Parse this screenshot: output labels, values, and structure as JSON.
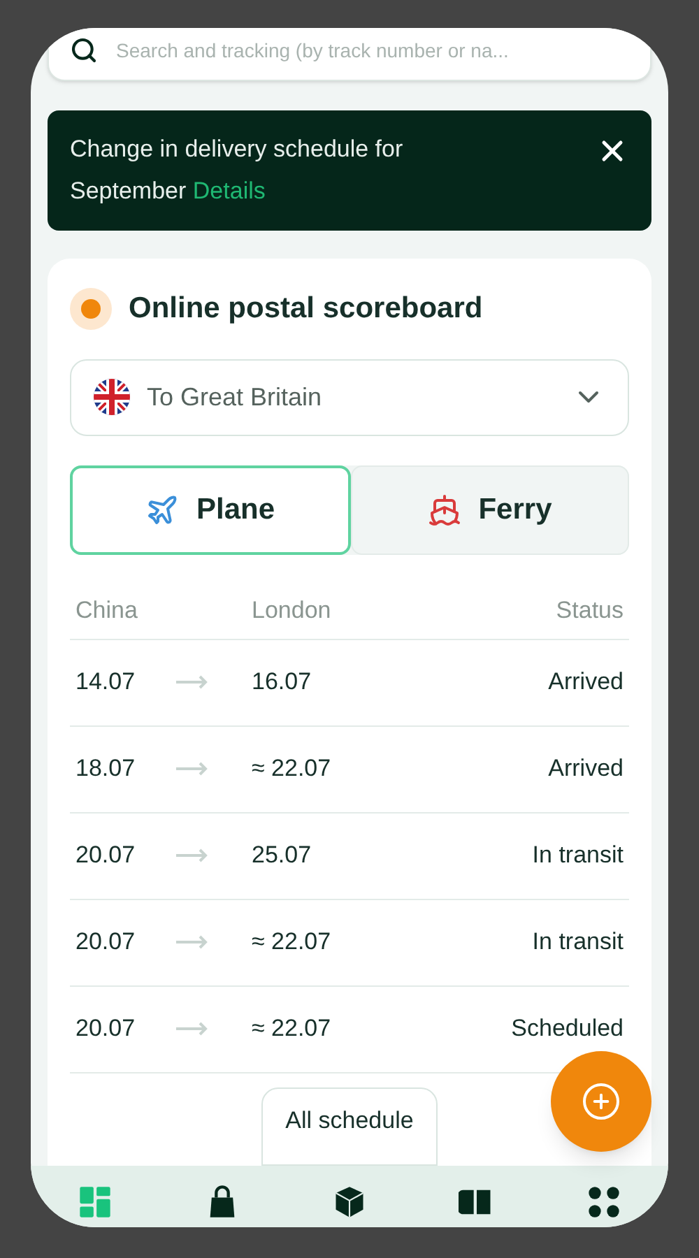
{
  "search": {
    "placeholder": "Search and tracking (by track number or na..."
  },
  "banner": {
    "text": "Change in delivery schedule for September",
    "link": "Details"
  },
  "scoreboard": {
    "title": "Online postal scoreboard",
    "destination": "To Great Britain",
    "modes": [
      {
        "label": "Plane",
        "kind": "plane",
        "selected": true
      },
      {
        "label": "Ferry",
        "kind": "ferry",
        "selected": false
      }
    ],
    "columns": [
      "China",
      "London",
      "Status"
    ],
    "rows": [
      {
        "from": "14.07",
        "to": "16.07",
        "status": "Arrived"
      },
      {
        "from": "18.07",
        "to": "≈ 22.07",
        "status": "Arrived"
      },
      {
        "from": "20.07",
        "to": "25.07",
        "status": "In transit"
      },
      {
        "from": "20.07",
        "to": "≈ 22.07",
        "status": "In transit"
      },
      {
        "from": "20.07",
        "to": "≈ 22.07",
        "status": "Scheduled"
      }
    ],
    "all_button": "All schedule"
  },
  "nav": [
    {
      "kind": "dashboard",
      "selected": true
    },
    {
      "kind": "bag",
      "selected": false
    },
    {
      "kind": "box",
      "selected": false
    },
    {
      "kind": "ticket",
      "selected": false
    },
    {
      "kind": "apps",
      "selected": false
    }
  ]
}
